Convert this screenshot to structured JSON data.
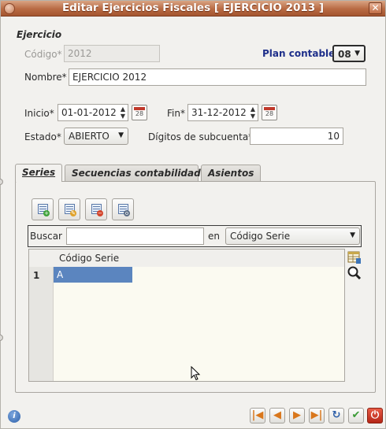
{
  "window": {
    "title": "Editar Ejercicios Fiscales [ EJERCICIO 2013 ]",
    "close_glyph": "✕"
  },
  "form": {
    "section_title": "Ejercicio",
    "codigo_label": "Código*",
    "codigo_value": "2012",
    "plan_label": "Plan contable",
    "plan_value": "08",
    "nombre_label": "Nombre*",
    "nombre_value": "EJERCICIO 2012",
    "inicio_label": "Inicio*",
    "inicio_value": "01-01-2012",
    "fin_label": "Fin*",
    "fin_value": "31-12-2012",
    "calendar_day": "28",
    "estado_label": "Estado*",
    "estado_value": "ABIERTO",
    "digitos_label": "Dígitos de subcuenta*",
    "digitos_value": "10"
  },
  "tabs": [
    {
      "label": "Series",
      "active": true
    },
    {
      "label": "Secuencias contabilidad",
      "active": false
    },
    {
      "label": "Asientos",
      "active": false
    }
  ],
  "toolbar": {
    "icons": [
      "new-record-icon",
      "edit-record-icon",
      "delete-record-icon",
      "view-record-icon"
    ]
  },
  "search": {
    "label": "Buscar",
    "value": "",
    "en_label": "en",
    "field_value": "Código Serie"
  },
  "table": {
    "columns": [
      "Código Serie"
    ],
    "rows": [
      {
        "num": "1",
        "codigo_serie": "A"
      }
    ]
  },
  "colors": {
    "titlebar": "#b86a43",
    "plan_label": "#1e2f8a",
    "selection": "#5b85bf"
  },
  "navigation": {
    "icons": [
      "first-icon",
      "previous-icon",
      "next-icon",
      "last-icon",
      "refresh-icon",
      "accept-icon",
      "cancel-icon"
    ]
  }
}
